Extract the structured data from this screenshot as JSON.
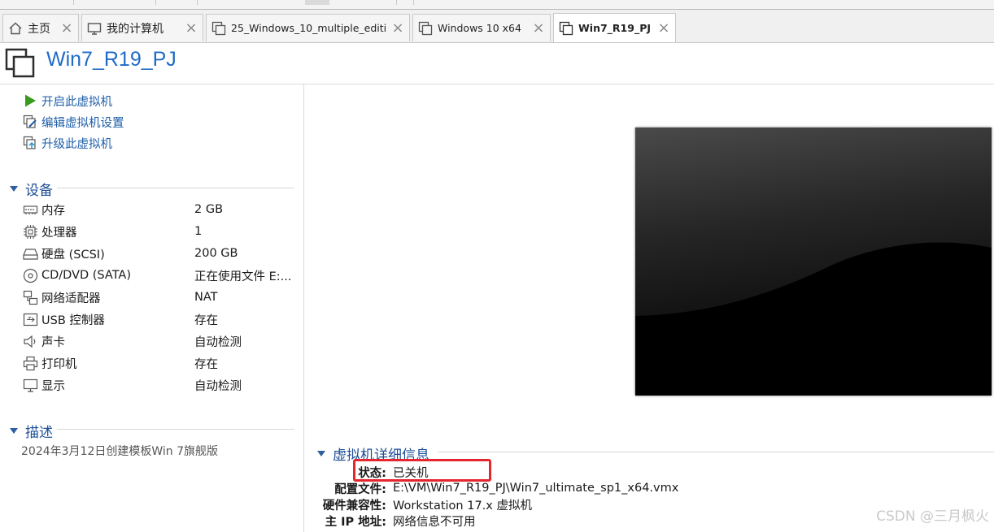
{
  "tabs": [
    {
      "label": "主页",
      "icon": "home-icon",
      "active": false
    },
    {
      "label": "我的计算机",
      "icon": "computer-icon",
      "active": false
    },
    {
      "label": "25_Windows_10_multiple_editi...",
      "icon": "vm-icon",
      "active": false
    },
    {
      "label": "Windows 10 x64",
      "icon": "vm-icon",
      "active": false
    },
    {
      "label": "Win7_R19_PJ",
      "icon": "vm-icon",
      "active": true
    }
  ],
  "header": {
    "title": "Win7_R19_PJ"
  },
  "actions": [
    {
      "label": "开启此虚拟机",
      "icon": "play-icon"
    },
    {
      "label": "编辑虚拟机设置",
      "icon": "edit-settings-icon"
    },
    {
      "label": "升级此虚拟机",
      "icon": "upgrade-icon"
    }
  ],
  "devices_section": {
    "title": "设备"
  },
  "devices": [
    {
      "name": "内存",
      "value": "2 GB",
      "icon": "memory-icon"
    },
    {
      "name": "处理器",
      "value": "1",
      "icon": "cpu-icon"
    },
    {
      "name": "硬盘 (SCSI)",
      "value": "200 GB",
      "icon": "hard-disk-icon"
    },
    {
      "name": "CD/DVD (SATA)",
      "value": "正在使用文件 E:...",
      "icon": "cd-dvd-icon"
    },
    {
      "name": "网络适配器",
      "value": "NAT",
      "icon": "network-adapter-icon"
    },
    {
      "name": "USB 控制器",
      "value": "存在",
      "icon": "usb-icon"
    },
    {
      "name": "声卡",
      "value": "自动检测",
      "icon": "speaker-icon"
    },
    {
      "name": "打印机",
      "value": "存在",
      "icon": "printer-icon"
    },
    {
      "name": "显示",
      "value": "自动检测",
      "icon": "display-icon"
    }
  ],
  "description_section": {
    "title": "描述",
    "text": "2024年3月12日创建模板Win 7旗舰版"
  },
  "details": {
    "title": "虚拟机详细信息",
    "rows": [
      {
        "label": "状态:",
        "value": "已关机"
      },
      {
        "label": "配置文件:",
        "value": "E:\\VM\\Win7_R19_PJ\\Win7_ultimate_sp1_x64.vmx"
      },
      {
        "label": "硬件兼容性:",
        "value": "Workstation 17.x 虚拟机"
      },
      {
        "label": "主 IP 地址:",
        "value": "网络信息不可用"
      }
    ]
  },
  "watermark": "CSDN @三月枫火",
  "colors": {
    "accent": "#1f6bc7",
    "highlight": "#e5262f",
    "play": "#3a9a1c"
  }
}
